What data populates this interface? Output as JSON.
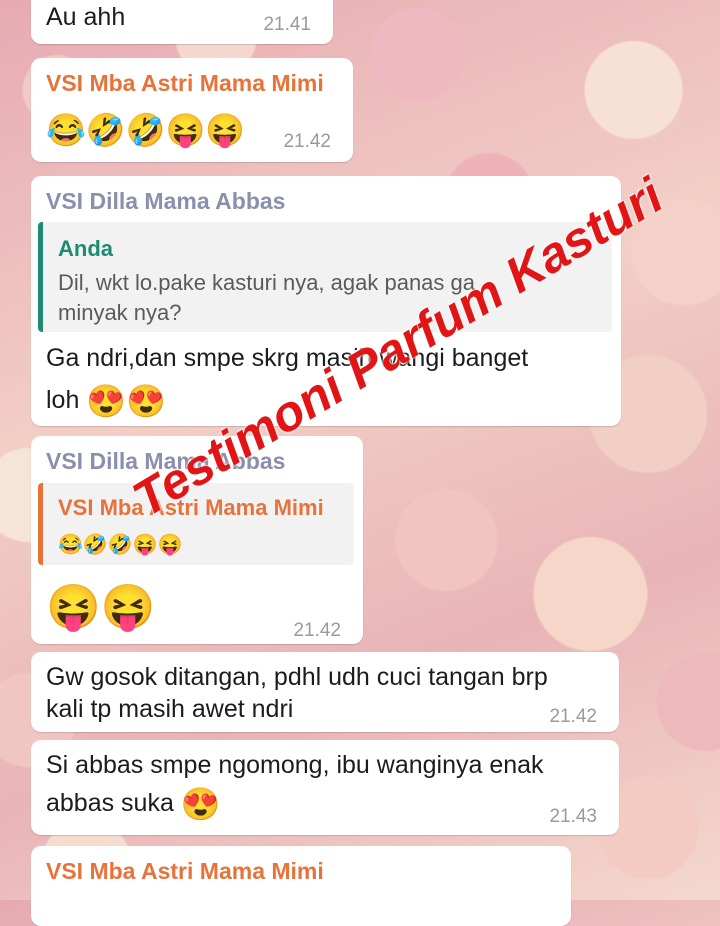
{
  "messages": [
    {
      "text": "Au ahh",
      "time": "21.41"
    },
    {
      "sender": "VSI Mba Astri Mama Mimi",
      "emojis": "😂🤣🤣😝😝",
      "time": "21.42"
    },
    {
      "sender": "VSI Dilla Mama Abbas",
      "quote": {
        "name": "Anda",
        "line1": "Dil, wkt lo.pake kasturi nya, agak panas ga",
        "line2": "minyak nya?"
      },
      "line1": "Ga ndri,dan smpe skrg masih wangi banget",
      "line2": "loh",
      "emojis": "😍😍"
    },
    {
      "sender": "VSI Dilla Mama Abbas",
      "quote": {
        "name": "VSI Mba Astri Mama Mimi",
        "emojis": "😂🤣🤣😝😝"
      },
      "emojis": "😝😝",
      "time": "21.42"
    },
    {
      "line1": "Gw gosok ditangan, pdhl udh cuci tangan brp",
      "line2": "kali tp masih awet ndri",
      "time": "21.42"
    },
    {
      "line1": "Si abbas smpe ngomong, ibu wanginya enak",
      "line2": "abbas suka",
      "emojis": "😍",
      "time": "21.43"
    },
    {
      "sender": "VSI Mba Astri Mama Mimi"
    }
  ],
  "watermark": "Testimoni Parfum Kasturi",
  "colors": {
    "orange_sender": "#e8733a",
    "slate_sender": "#8a8fae",
    "teal_quote": "#1f8a73",
    "watermark": "#e11515"
  }
}
